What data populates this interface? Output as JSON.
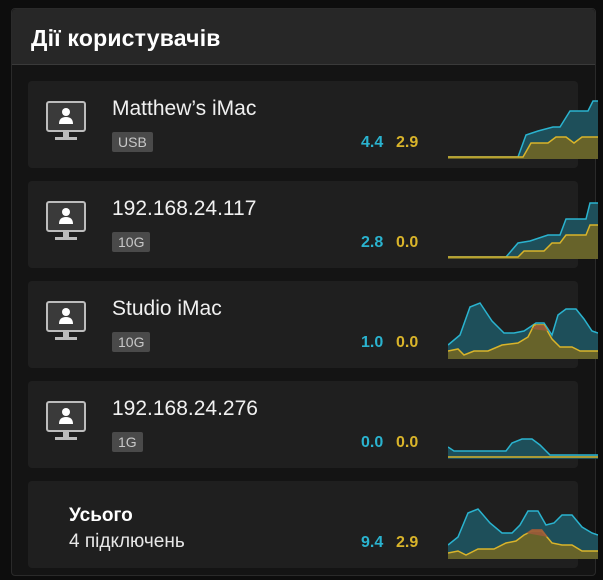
{
  "panel": {
    "title": "Дії користувачів"
  },
  "colors": {
    "incoming": "#2ab3cf",
    "outgoing": "#d9b42a",
    "fill_in": "#1e4f5a",
    "fill_out": "#6b6428"
  },
  "users": [
    {
      "name": "Matthew’s iMac",
      "link": "USB",
      "in": "4.4",
      "out": "2.9",
      "icon": "monitor-user-icon"
    },
    {
      "name": "192.168.24.117",
      "link": "10G",
      "in": "2.8",
      "out": "0.0",
      "icon": "monitor-user-icon"
    },
    {
      "name": "Studio iMac",
      "link": "10G",
      "in": "1.0",
      "out": "0.0",
      "icon": "monitor-user-icon"
    },
    {
      "name": "192.168.24.276",
      "link": "1G",
      "in": "0.0",
      "out": "0.0",
      "icon": "monitor-user-icon"
    }
  ],
  "total": {
    "label": "Усього",
    "connections": "4 підключень",
    "in": "9.4",
    "out": "2.9"
  }
}
